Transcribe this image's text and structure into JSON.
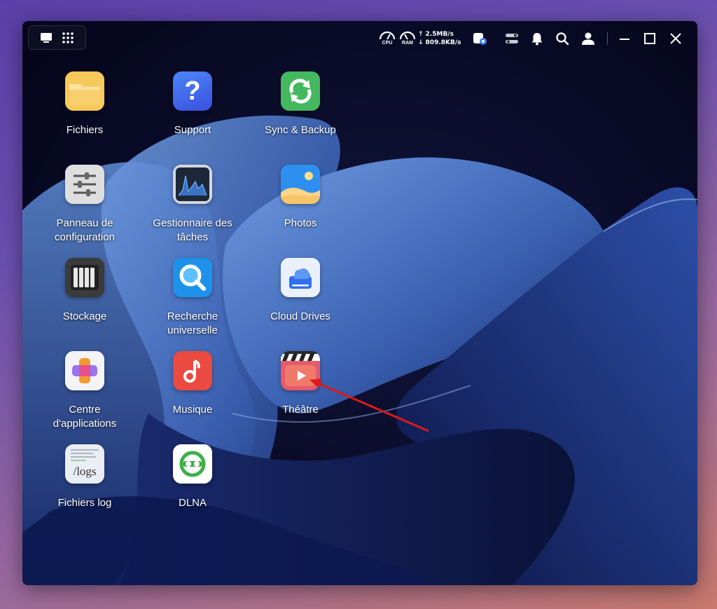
{
  "window": {
    "accent": "#2f6ff0"
  },
  "topbar": {
    "view_buttons": [
      {
        "icon": "desktop-icon"
      },
      {
        "icon": "app-grid-icon"
      }
    ],
    "cpu_label": "CPU",
    "ram_label": "RAM",
    "upload_speed": "2.5MB/s",
    "download_speed": "809.8KB/s",
    "icons": [
      "storage-status-icon",
      "widget-toggle-icon",
      "notification-bell-icon",
      "search-icon",
      "user-icon"
    ],
    "controls": [
      "minimize-icon",
      "maximize-icon",
      "close-icon"
    ]
  },
  "apps": [
    {
      "label": "Fichiers",
      "icon": "folder-icon",
      "color": "#f2c14e"
    },
    {
      "label": "Support",
      "icon": "question-icon",
      "color": "#3d6ff0"
    },
    {
      "label": "Sync & Backup",
      "icon": "sync-icon",
      "color": "#3fae5a"
    },
    {
      "label": "Panneau de\nconfiguration",
      "icon": "sliders-icon",
      "color": "#d7d7d7"
    },
    {
      "label": "Gestionnaire des\ntâches",
      "icon": "activity-chart-icon",
      "color": "#1d2a3a"
    },
    {
      "label": "Photos",
      "icon": "photo-icon",
      "color": "#2a8ef2"
    },
    {
      "label": "Stockage",
      "icon": "disk-array-icon",
      "color": "#3a3a3a"
    },
    {
      "label": "Recherche\nuniverselle",
      "icon": "magnifier-icon",
      "color": "#1d8fe8"
    },
    {
      "label": "Cloud Drives",
      "icon": "cloud-drive-icon",
      "color": "#e9f0fb"
    },
    {
      "label": "Centre\nd'applications",
      "icon": "app-center-icon",
      "color": "#f2f2f5"
    },
    {
      "label": "Musique",
      "icon": "music-note-icon",
      "color": "#e9473e"
    },
    {
      "label": "Théâtre",
      "icon": "clapperboard-icon",
      "color": "#e4566a"
    },
    {
      "label": "Fichiers log",
      "icon": "logs-icon",
      "color": "#e8ecf3",
      "icon_text": "/logs"
    },
    {
      "label": "DLNA",
      "icon": "dlna-icon",
      "color": "#ffffff"
    }
  ],
  "annotation": {
    "color": "#e01818"
  }
}
